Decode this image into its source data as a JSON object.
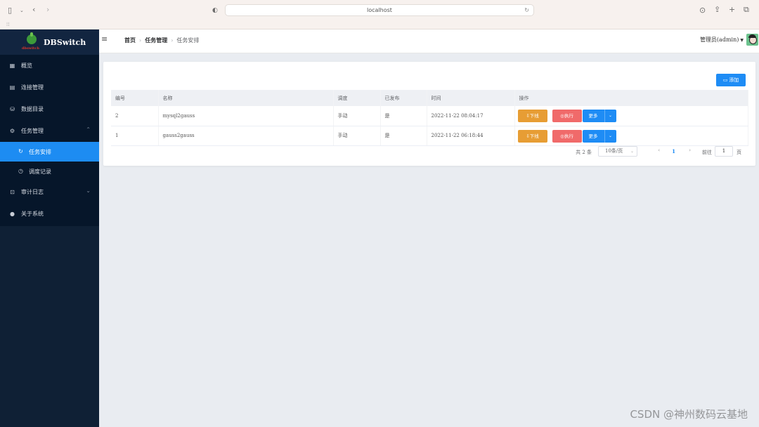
{
  "browser": {
    "url": "localhost"
  },
  "sidebar": {
    "brand": "DBSwitch",
    "brand_sub": "dbswitch",
    "items": [
      {
        "label": "概览",
        "icon": "grid-icon"
      },
      {
        "label": "连接管理",
        "icon": "clipboard-icon"
      },
      {
        "label": "数据目录",
        "icon": "database-icon"
      },
      {
        "label": "任务管理",
        "icon": "gear-icon",
        "expanded": true
      },
      {
        "label": "任务安排",
        "icon": "refresh-icon",
        "active": true
      },
      {
        "label": "调度记录",
        "icon": "clock-icon"
      },
      {
        "label": "审计日志",
        "icon": "audit-icon"
      },
      {
        "label": "关于系统",
        "icon": "user-icon"
      }
    ]
  },
  "header": {
    "breadcrumb": [
      "首页",
      "任务管理",
      "任务安排"
    ],
    "user": "管理员(admin)"
  },
  "toolbar": {
    "add_label": "添加"
  },
  "table": {
    "columns": [
      "编号",
      "名称",
      "调度",
      "已发布",
      "时间",
      "操作"
    ],
    "rows": [
      {
        "id": "2",
        "name": "mysql2gauss",
        "schedule": "手动",
        "published": "是",
        "time": "2022-11-22 08:04:17"
      },
      {
        "id": "1",
        "name": "gauss2gauss",
        "schedule": "手动",
        "published": "是",
        "time": "2022-11-22 06:18:44"
      }
    ],
    "actions": {
      "offline": "下线",
      "run": "执行",
      "more": "更多"
    }
  },
  "pagination": {
    "total": "共 2 条",
    "page_size": "10条/页",
    "current_page": "1",
    "goto_label": "前往",
    "goto_value": "1",
    "page_suffix": "页"
  },
  "watermark": "CSDN @神州数码云基地",
  "colors": {
    "sidebar_bg": "#06162a",
    "accent": "#1e8cf5",
    "warning": "#e79d34",
    "danger": "#f06a6a"
  }
}
